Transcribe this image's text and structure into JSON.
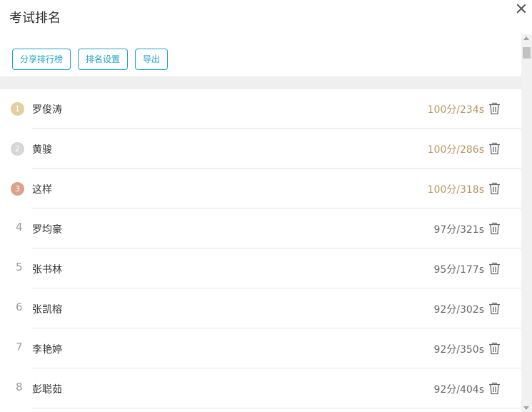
{
  "dialog": {
    "title": "考试排名"
  },
  "toolbar": {
    "share_label": "分享排行榜",
    "settings_label": "排名设置",
    "export_label": "导出"
  },
  "colors": {
    "accent": "#1fa3c9",
    "gold": "#e3cfa0",
    "silver": "#d6d6d6",
    "bronze": "#dba28a",
    "top_score": "#b89463"
  },
  "ranking": [
    {
      "rank": "1",
      "name": "罗俊涛",
      "score": "100分/234s",
      "medal": "gold"
    },
    {
      "rank": "2",
      "name": "黄骏",
      "score": "100分/286s",
      "medal": "silver"
    },
    {
      "rank": "3",
      "name": "这样",
      "score": "100分/318s",
      "medal": "bronze"
    },
    {
      "rank": "4",
      "name": "罗均豪",
      "score": "97分/321s",
      "medal": ""
    },
    {
      "rank": "5",
      "name": "张书林",
      "score": "95分/177s",
      "medal": ""
    },
    {
      "rank": "6",
      "name": "张凯榕",
      "score": "92分/302s",
      "medal": ""
    },
    {
      "rank": "7",
      "name": "李艳婷",
      "score": "92分/350s",
      "medal": ""
    },
    {
      "rank": "8",
      "name": "彭聪茹",
      "score": "92分/404s",
      "medal": ""
    }
  ]
}
